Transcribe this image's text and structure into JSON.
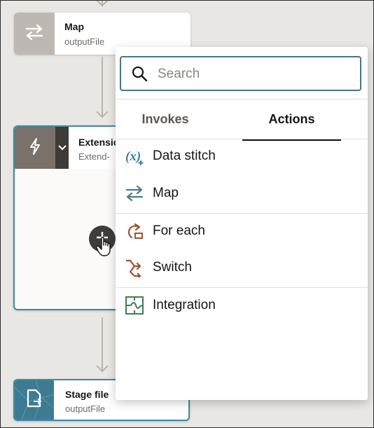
{
  "flow": {
    "map_node": {
      "title": "Map",
      "subtitle": "outputFile"
    },
    "extension_node": {
      "title": "Extensio",
      "subtitle": "Extend-"
    },
    "stage_node": {
      "title": "Stage file",
      "subtitle": "outputFile"
    },
    "add_button_icon": "plus-icon"
  },
  "popover": {
    "search": {
      "placeholder": "Search",
      "value": ""
    },
    "tabs": [
      {
        "label": "Invokes",
        "selected": false
      },
      {
        "label": "Actions",
        "selected": true
      }
    ],
    "items": [
      {
        "label": "Data stitch",
        "icon": "data-stitch-icon"
      },
      {
        "label": "Map",
        "icon": "map-icon"
      },
      {
        "label": "For each",
        "icon": "for-each-icon"
      },
      {
        "label": "Switch",
        "icon": "switch-icon"
      },
      {
        "label": "Integration",
        "icon": "integration-icon"
      }
    ]
  },
  "colors": {
    "canvas": "#e9e7e3",
    "teal_border": "#3c8aa3",
    "search_border": "#4a7584",
    "map_icon": "#4a7a93",
    "for_each_icon": "#a0522d",
    "switch_icon": "#a0522d",
    "integration_icon": "#3f7d55"
  }
}
